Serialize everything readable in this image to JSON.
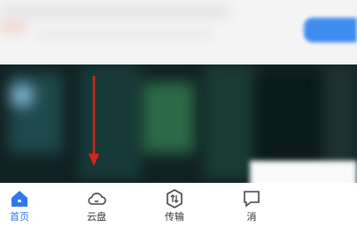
{
  "colors": {
    "accent": "#2f77f1",
    "annotation_arrow": "#d9241c"
  },
  "bottom_nav": {
    "items": [
      {
        "label": "首页",
        "icon": "home-icon",
        "active": true
      },
      {
        "label": "云盘",
        "icon": "cloud-icon",
        "active": false
      },
      {
        "label": "传输",
        "icon": "transfer-icon",
        "active": false
      },
      {
        "label": "消",
        "icon": "message-icon",
        "active": false
      }
    ]
  }
}
